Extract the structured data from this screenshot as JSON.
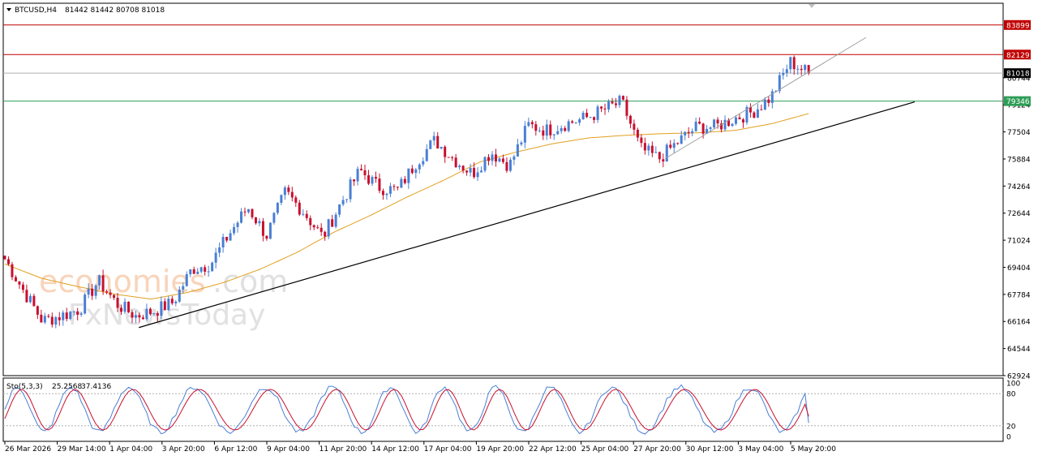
{
  "header": {
    "symbol": "BTCUSD,H4",
    "ohlc": "81442 81442 80708 81018"
  },
  "watermark": {
    "word1": "economies",
    "word2": ".com",
    "word3": "FxNewsToday"
  },
  "price_tags": [
    {
      "label": "83899",
      "value": 83899,
      "color": "#c00000",
      "line": true
    },
    {
      "label": "82129",
      "value": 82129,
      "color": "#c00000",
      "line": true
    },
    {
      "label": "81018",
      "value": 81018,
      "color": "#000000",
      "line": true
    },
    {
      "label": "79346",
      "value": 79346,
      "color": "#2e9e57",
      "line": true
    }
  ],
  "colors": {
    "bull": "#4a7fd4",
    "bear": "#c8102e",
    "ma": "#e0a020",
    "trendline": "#000000",
    "trendline_light": "#a0a0a0",
    "stoch_main": "#4a7fd4",
    "stoch_signal": "#c8102e"
  },
  "chart_data": {
    "type": "candlestick",
    "symbol": "BTCUSD",
    "timeframe": "H4",
    "ylim": [
      62924,
      85200
    ],
    "y_ticks": [
      62924,
      64544,
      66164,
      67784,
      69404,
      71024,
      72644,
      74264,
      75884,
      77504,
      79124,
      80744
    ],
    "x_ticks": [
      "26 Mar 2026",
      "29 Mar 14:00",
      "1 Apr 04:00",
      "3 Apr 20:00",
      "6 Apr 12:00",
      "9 Apr 04:00",
      "11 Apr 20:00",
      "14 Apr 12:00",
      "17 Apr 04:00",
      "19 Apr 20:00",
      "22 Apr 12:00",
      "25 Apr 04:00",
      "27 Apr 20:00",
      "30 Apr 12:00",
      "3 May 04:00",
      "5 May 20:00"
    ],
    "close_anchors": [
      69900,
      68000,
      66200,
      66500,
      66900,
      68600,
      67200,
      66500,
      66800,
      67300,
      69300,
      69600,
      71400,
      73000,
      71300,
      73900,
      72700,
      71200,
      73300,
      75200,
      74200,
      74000,
      75700,
      77000,
      75900,
      75000,
      76300,
      75500,
      77900,
      77600,
      78000,
      78300,
      78800,
      79300,
      76500,
      75900,
      76900,
      77800,
      77800,
      78300,
      78700,
      79600,
      81700,
      81018
    ],
    "candle_count": 222,
    "ma_anchors": [
      69600,
      68750,
      68250,
      67800,
      67500,
      67900,
      68500,
      69300,
      70300,
      71500,
      72500,
      73600,
      74600,
      75700,
      76300,
      76800,
      77150,
      77300,
      77400,
      77450,
      77600,
      78000,
      78600
    ],
    "support_trendline": {
      "from": [
        "1 Apr 04:00",
        65800
      ],
      "to": [
        "end",
        79300
      ]
    },
    "inner_trendline": {
      "from": [
        "29 Apr",
        75900
      ],
      "to": [
        "end",
        81700
      ]
    },
    "stochastic": {
      "label": "Sto(5,3,3)",
      "main": "25.2568",
      "signal": "37.4136",
      "levels": [
        80,
        20
      ],
      "ylim": [
        0,
        100
      ],
      "y_ticks": [
        "100",
        "80",
        "20",
        "0"
      ]
    }
  }
}
